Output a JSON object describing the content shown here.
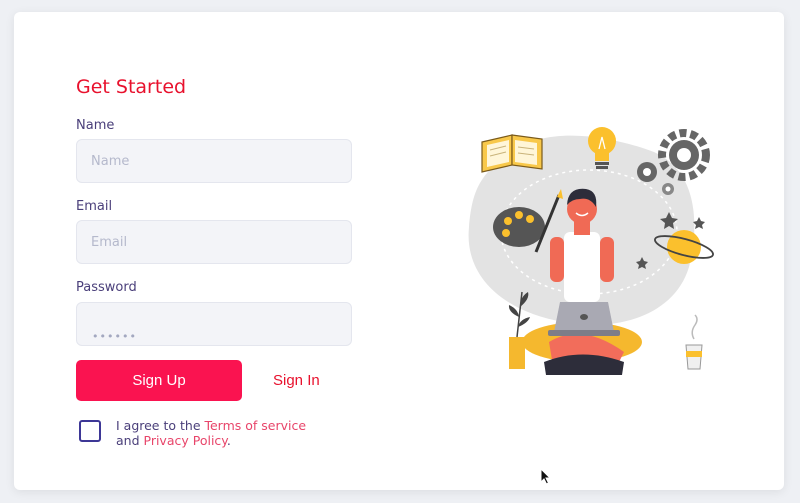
{
  "form": {
    "title": "Get Started",
    "name_label": "Name",
    "name_placeholder": "Name",
    "name_value": "",
    "email_label": "Email",
    "email_placeholder": "Email",
    "email_value": "",
    "password_label": "Password",
    "password_value": "••••••",
    "signup_label": "Sign Up",
    "signin_label": "Sign In",
    "agree_prefix": "I agree to the ",
    "terms_label": "Terms of service",
    "agree_and": "and ",
    "privacy_label": "Privacy Policy",
    "agree_suffix": ".",
    "agree_checked": false
  },
  "colors": {
    "accent": "#e8112d",
    "button": "#fa1350",
    "label": "#4a3f7a",
    "checkbox_border": "#3d3796"
  },
  "illustration": {
    "icon": "person-with-laptop-illustration"
  }
}
